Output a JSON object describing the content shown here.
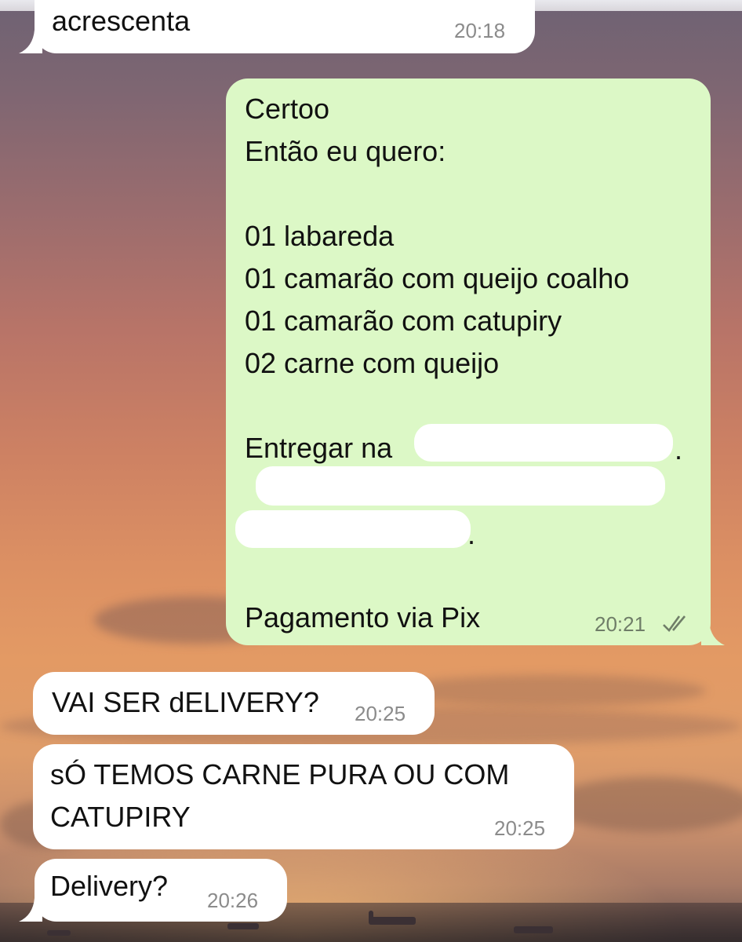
{
  "messages": [
    {
      "text": "acrescenta",
      "time": "20:18"
    },
    {
      "lines": [
        "Certoo",
        "Então eu quero:",
        "",
        "01 labareda",
        "01 camarão com queijo coalho",
        "01 camarão com catupiry",
        "02 carne com queijo",
        "",
        "Entregar na",
        "",
        "",
        "",
        "Pagamento via Pix"
      ],
      "time": "20:21",
      "status_icon": "double-check-icon"
    },
    {
      "text": "VAI SER dELIVERY?",
      "time": "20:25"
    },
    {
      "lines": [
        "sÓ TEMOS CARNE PURA OU COM",
        "CATUPIRY"
      ],
      "time": "20:25"
    },
    {
      "text": "Delivery?",
      "time": "20:26"
    }
  ]
}
